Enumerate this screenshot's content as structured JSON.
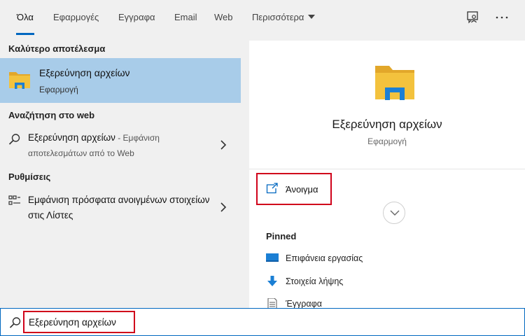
{
  "tabs": [
    {
      "label": "Όλα",
      "active": true
    },
    {
      "label": "Εφαρμογές"
    },
    {
      "label": "Εγγραφα"
    },
    {
      "label": "Email"
    },
    {
      "label": "Web"
    },
    {
      "label": "Περισσότερα"
    }
  ],
  "top_icons": [
    "feedback-icon",
    "more-options-icon"
  ],
  "left": {
    "best_match_title": "Καλύτερο αποτέλεσμα",
    "best_match": {
      "title": "Εξερεύνηση αρχείων",
      "subtitle": "Εφαρμογή",
      "icon": "folder-icon"
    },
    "web_title": "Αναζήτηση στο web",
    "web_result": {
      "title": "Εξερεύνηση αρχείων",
      "suffix": " - Εμφάνιση αποτελεσμάτων από το Web",
      "icon": "search-icon"
    },
    "settings_title": "Ρυθμίσεις",
    "settings_result": {
      "title": "Εμφάνιση πρόσφατα ανοιγμένων στοιχείων στις Λίστες",
      "icon": "list-settings-icon"
    }
  },
  "right": {
    "app_name": "Εξερεύνηση αρχείων",
    "app_type": "Εφαρμογή",
    "open_label": "Άνοιγμα",
    "pinned_title": "Pinned",
    "pinned": [
      {
        "label": "Επιφάνεια εργασίας",
        "icon": "desktop-icon"
      },
      {
        "label": "Στοιχεία λήψης",
        "icon": "download-arrow-icon"
      },
      {
        "label": "Έγγραφα",
        "icon": "document-icon"
      }
    ]
  },
  "search": {
    "value": "Εξερεύνηση αρχείων"
  },
  "colors": {
    "accent": "#0067c0",
    "selection": "#a8cce9",
    "highlight_box": "#d0021b",
    "folder_yellow": "#f3c23d",
    "folder_blue": "#1b7fd4"
  }
}
